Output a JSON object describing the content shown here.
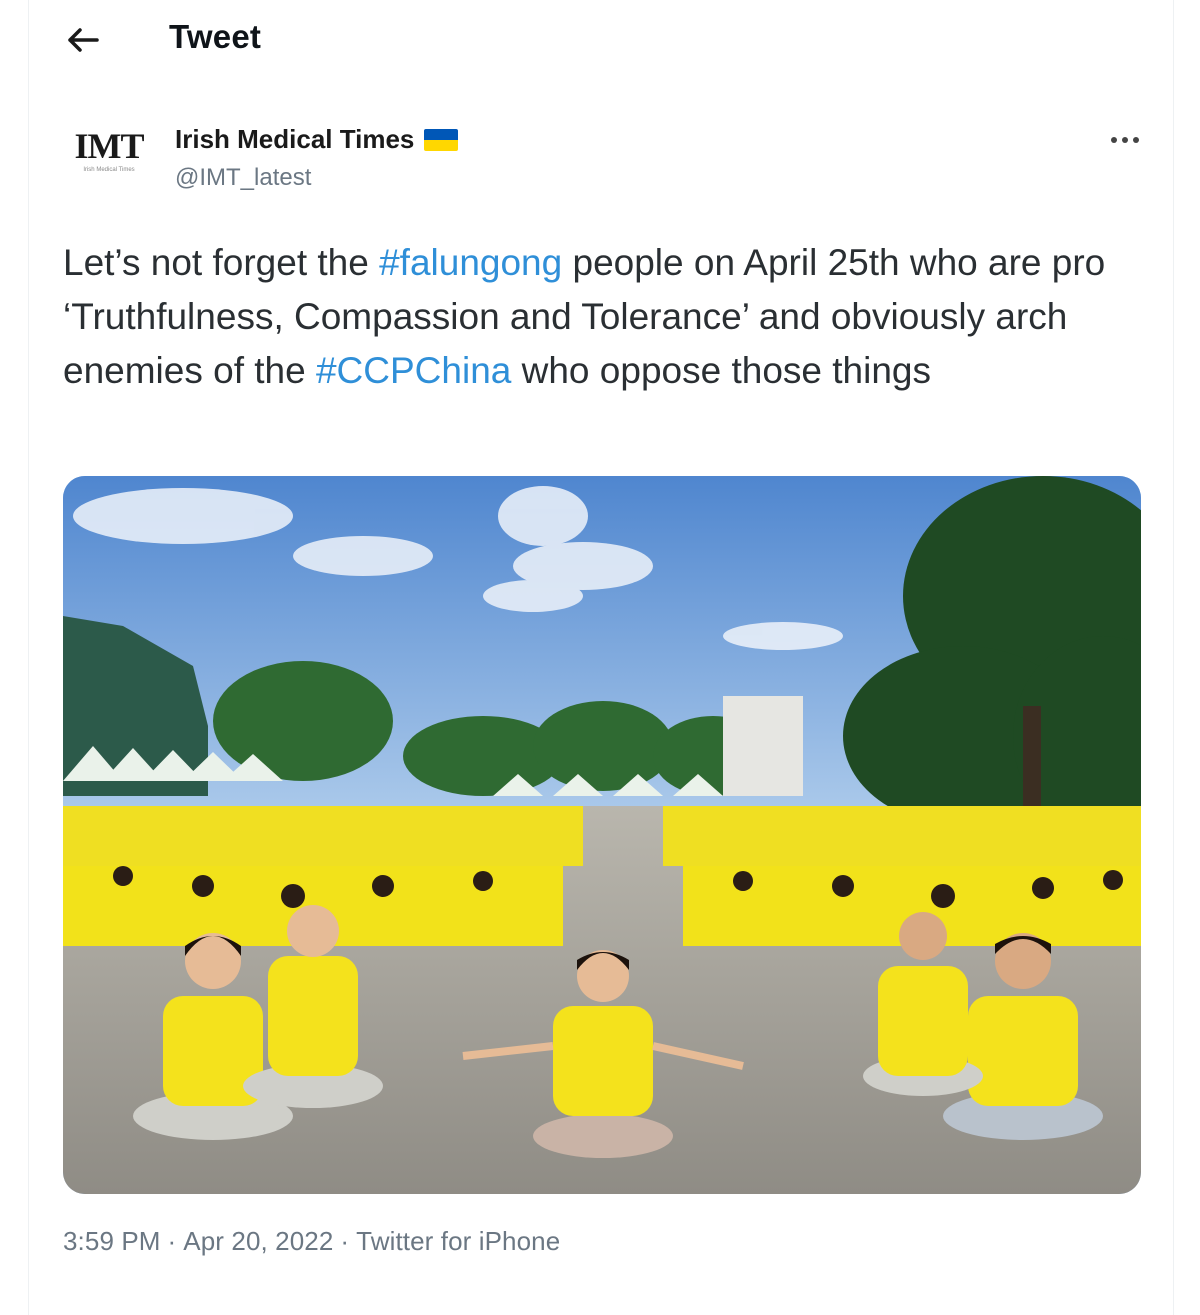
{
  "header": {
    "back_icon": "arrow-left-icon",
    "title": "Tweet"
  },
  "author": {
    "avatar_logo": "IMT",
    "avatar_tagline": "Irish Medical Times",
    "display_name": "Irish Medical Times",
    "badge_icon": "ukraine-flag-icon",
    "flag_colors": [
      "#0057b7",
      "#ffd700"
    ],
    "handle": "@IMT_latest",
    "more_icon": "more-horizontal-icon"
  },
  "tweet": {
    "text_parts": [
      {
        "text": "Let’s not forget the ",
        "type": "text"
      },
      {
        "text": "#falungong",
        "type": "hashtag"
      },
      {
        "text": " people on April 25th who are pro ‘Truthfulness, Compassion and Tolerance’ and obviously arch enemies of the ",
        "type": "text"
      },
      {
        "text": "#CCPChina",
        "type": "hashtag"
      },
      {
        "text": " who oppose those things",
        "type": "text"
      }
    ],
    "hashtag_color": "#2f8fd8"
  },
  "media": {
    "kind": "photo"
  },
  "meta": {
    "time": "3:59 PM",
    "date": "Apr 20, 2022",
    "source": "Twitter for iPhone",
    "separator": "·"
  }
}
